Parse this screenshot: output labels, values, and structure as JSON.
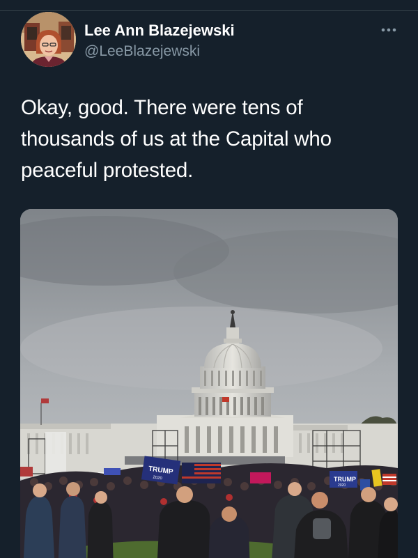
{
  "tweet": {
    "author": {
      "display_name": "Lee Ann Blazejewski",
      "handle": "@LeeBlazejewski"
    },
    "text": "Okay, good. There were tens of thousands of us at the Capital who peaceful protested.",
    "media": {
      "alt": "",
      "sign_text_1": "TRUMP",
      "sign_text_2": "TRUMP",
      "sign_year": "2020"
    }
  },
  "icons": {
    "more": "more-horizontal-icon"
  },
  "colors": {
    "background": "#15202b",
    "text_primary": "#ffffff",
    "text_secondary": "#8899a6",
    "divider": "#38444d"
  }
}
